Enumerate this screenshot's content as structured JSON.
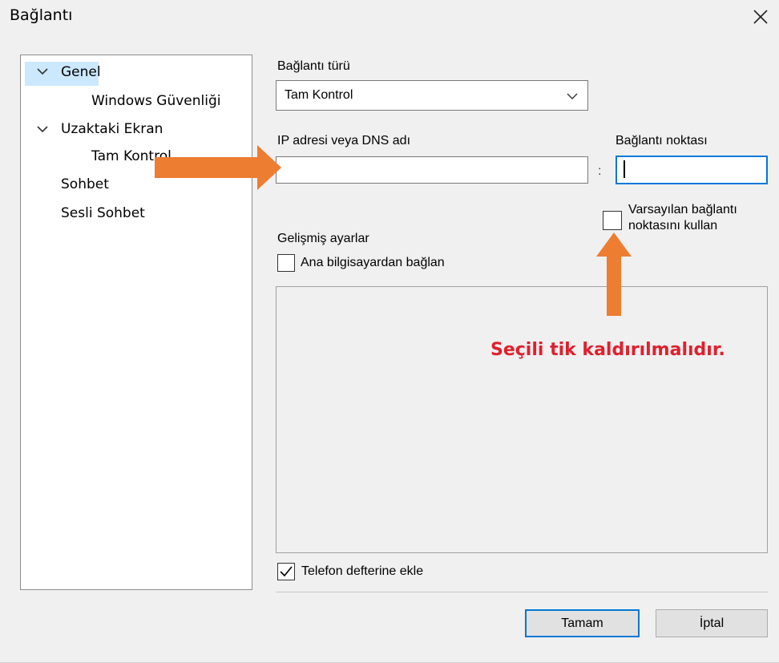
{
  "window": {
    "title": "Bağlantı",
    "close_icon": "close-icon"
  },
  "sidebar": {
    "items": [
      {
        "label": "Genel",
        "expanded": true,
        "selected": true
      },
      {
        "label": "Windows Güvenliği"
      },
      {
        "label": "Uzaktaki Ekran",
        "expanded": true
      },
      {
        "label": "Tam Kontrol"
      },
      {
        "label": "Sohbet"
      },
      {
        "label": "Sesli Sohbet"
      }
    ]
  },
  "form": {
    "connection_type_label": "Bağlantı türü",
    "connection_type_value": "Tam Kontrol",
    "ip_label": "IP adresi veya DNS adı",
    "ip_value": "",
    "separator": ":",
    "port_label": "Bağlantı noktası",
    "port_value": "",
    "default_port_line1": "Varsayılan bağlantı",
    "default_port_line2": "noktasını kullan",
    "default_port_checked": false,
    "advanced_label": "Gelişmiş ayarlar",
    "connect_from_host_label": "Ana bilgisayardan bağlan",
    "connect_from_host_checked": false,
    "phonebook_label": "Telefon defterine ekle",
    "phonebook_checked": true
  },
  "annotation": {
    "note": "Seçili tik kaldırılmalıdır.",
    "note_color": "#e0202e",
    "arrow_color": "#ed7d31"
  },
  "buttons": {
    "ok": "Tamam",
    "cancel": "İptal"
  },
  "colors": {
    "accent": "#0078d7",
    "selection": "#cce8ff"
  }
}
